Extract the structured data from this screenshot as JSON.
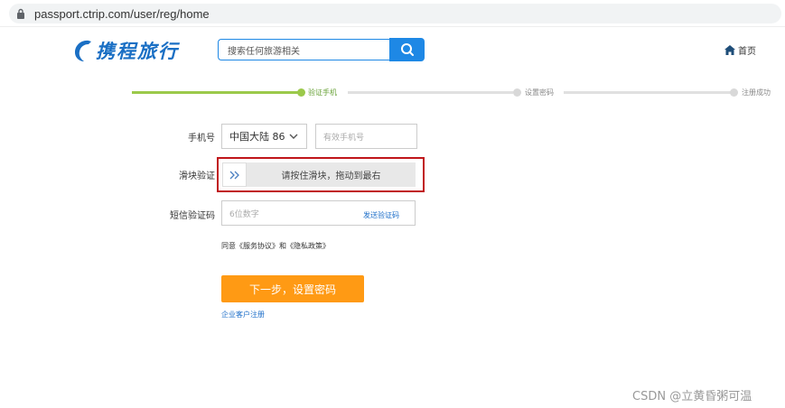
{
  "browser": {
    "url": "passport.ctrip.com/user/reg/home"
  },
  "header": {
    "logo_text": "携程旅行",
    "search_placeholder": "搜索任何旅游相关",
    "home_label": "首页"
  },
  "steps": [
    {
      "label": "验证手机",
      "state": "active"
    },
    {
      "label": "设置密码",
      "state": "inactive"
    },
    {
      "label": "注册成功",
      "state": "inactive"
    }
  ],
  "form": {
    "phone_label": "手机号",
    "country_value": "中国大陆 86",
    "phone_placeholder": "有效手机号",
    "slider_label": "滑块验证",
    "slider_text": "请按住滑块，拖动到最右",
    "sms_label": "短信验证码",
    "sms_placeholder": "6位数字",
    "sms_send": "发送验证码",
    "agreement": "同意《服务协议》和《隐私政策》",
    "next_button": "下一步，设置密码",
    "corp_link": "企业客户注册"
  },
  "watermark": "CSDN @立黄昏粥可温",
  "colors": {
    "brand_blue": "#1e88e5",
    "progress_green": "#9bc94a",
    "button_orange": "#ff9a14",
    "highlight_red": "#c0161a",
    "link_blue": "#1e6fc9"
  }
}
